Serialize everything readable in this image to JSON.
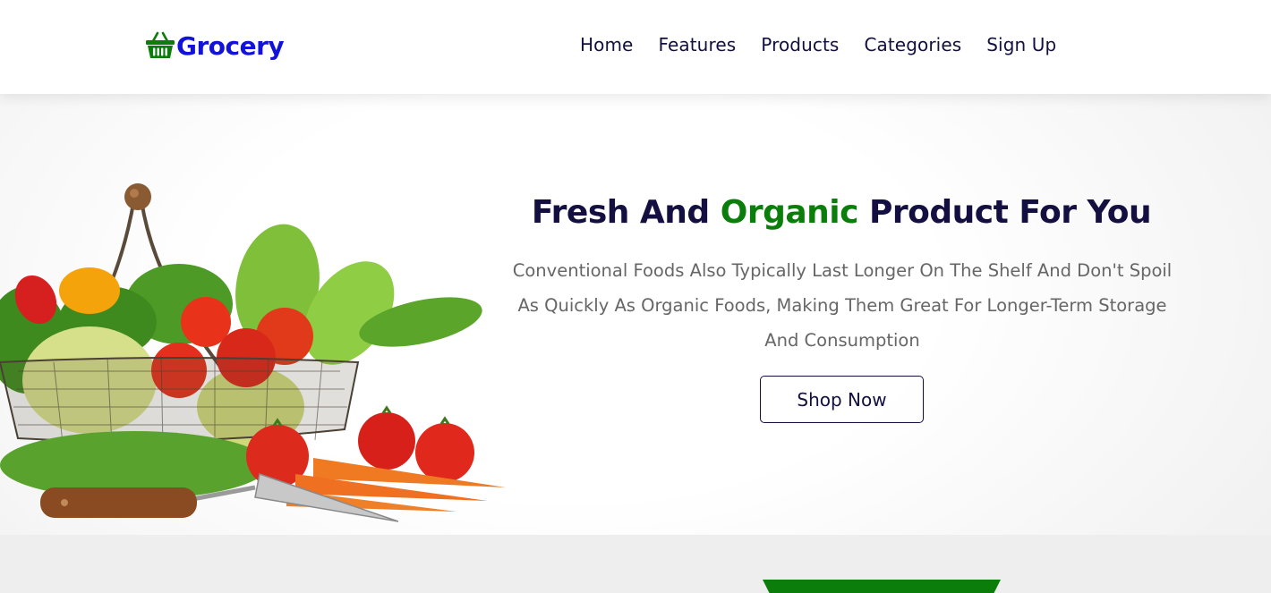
{
  "brand": {
    "name": "Grocery",
    "icon": "shopping-basket-icon",
    "color": "#1114d8",
    "icon_color": "#0a7d0a"
  },
  "nav": {
    "items": [
      {
        "label": "Home"
      },
      {
        "label": "Features"
      },
      {
        "label": "Products"
      },
      {
        "label": "Categories"
      },
      {
        "label": "Sign Up"
      }
    ]
  },
  "hero": {
    "title_part1": "Fresh And ",
    "title_highlight": "Organic",
    "title_part2": " Product For You",
    "description": "Conventional Foods Also Typically Last Longer On The Shelf And Don't Spoil As Quickly As Organic Foods, Making Them Great For Longer-Term Storage And Consumption",
    "button_label": "Shop Now",
    "image": "vegetable-basket-illustration"
  },
  "colors": {
    "heading": "#130f40",
    "accent_green": "#0a7d0a",
    "text_gray": "#666666",
    "section_bg": "#eeeeee"
  }
}
